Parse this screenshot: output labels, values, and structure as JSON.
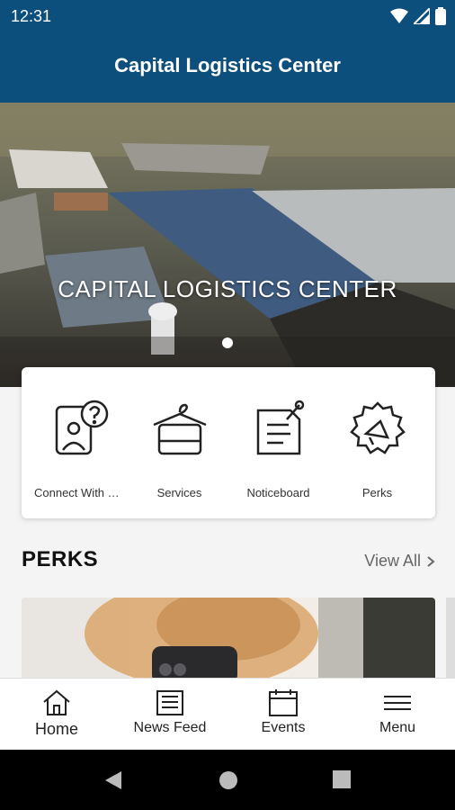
{
  "status": {
    "time": "12:31"
  },
  "appbar": {
    "title": "Capital Logistics Center"
  },
  "hero": {
    "caption": "CAPITAL LOGISTICS CENTER"
  },
  "quick_actions": [
    {
      "label": "Connect With M…",
      "icon": "contact-question-icon"
    },
    {
      "label": "Services",
      "icon": "hanger-towel-icon"
    },
    {
      "label": "Noticeboard",
      "icon": "notice-pin-icon"
    },
    {
      "label": "Perks",
      "icon": "megaphone-badge-icon"
    }
  ],
  "perks": {
    "title": "PERKS",
    "view_all": "View All"
  },
  "tabs": [
    {
      "label": "Home",
      "icon": "home-icon"
    },
    {
      "label": "News Feed",
      "icon": "newspaper-icon"
    },
    {
      "label": "Events",
      "icon": "calendar-icon"
    },
    {
      "label": "Menu",
      "icon": "hamburger-menu-icon"
    }
  ],
  "colors": {
    "brand": "#0d4f7c",
    "nav": "#000000"
  }
}
